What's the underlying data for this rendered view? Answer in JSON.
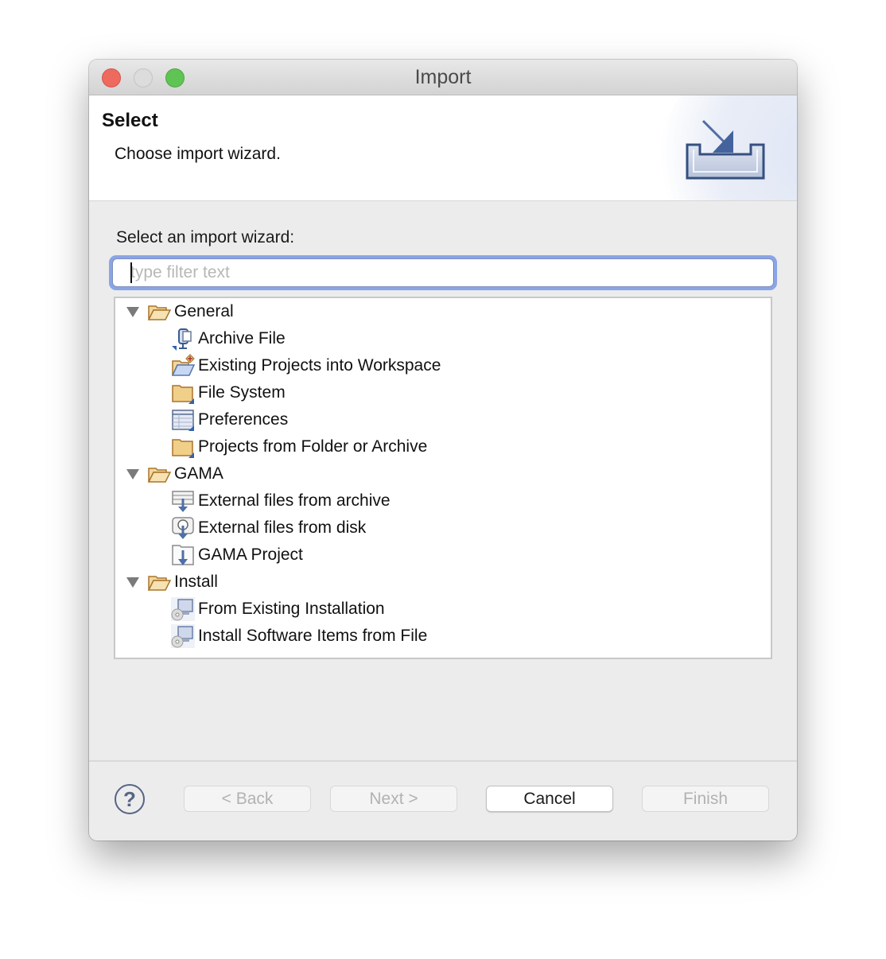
{
  "window": {
    "title": "Import",
    "controls": [
      "close",
      "minimize",
      "zoom"
    ]
  },
  "banner": {
    "title": "Select",
    "description": "Choose import wizard.",
    "icon": "import-wizard-icon"
  },
  "main": {
    "label": "Select an import wizard:",
    "filter": {
      "value": "",
      "placeholder": "type filter text"
    },
    "tree": [
      {
        "label": "General",
        "expanded": true,
        "icon": "folder-open-icon",
        "children": [
          {
            "label": "Archive File",
            "icon": "archive-file-icon"
          },
          {
            "label": "Existing Projects into Workspace",
            "icon": "existing-projects-icon"
          },
          {
            "label": "File System",
            "icon": "folder-icon"
          },
          {
            "label": "Preferences",
            "icon": "preferences-icon"
          },
          {
            "label": "Projects from Folder or Archive",
            "icon": "folder-icon"
          }
        ]
      },
      {
        "label": "GAMA",
        "expanded": true,
        "icon": "folder-open-icon",
        "children": [
          {
            "label": "External files from archive",
            "icon": "archive-download-icon"
          },
          {
            "label": "External files from disk",
            "icon": "disk-download-icon"
          },
          {
            "label": "GAMA Project",
            "icon": "project-download-icon"
          }
        ]
      },
      {
        "label": "Install",
        "expanded": true,
        "icon": "folder-open-icon",
        "children": [
          {
            "label": "From Existing Installation",
            "icon": "install-cd-icon"
          },
          {
            "label": "Install Software Items from File",
            "icon": "install-cd-icon"
          }
        ]
      }
    ]
  },
  "footer": {
    "help_icon": "?",
    "back": {
      "label": "< Back",
      "enabled": false
    },
    "next": {
      "label": "Next >",
      "enabled": false
    },
    "cancel": {
      "label": "Cancel",
      "enabled": true
    },
    "finish": {
      "label": "Finish",
      "enabled": false
    }
  },
  "colors": {
    "focus_ring": "#8aa5e6",
    "close": "#ee6a5f",
    "zoom": "#5fc454",
    "icon_blue": "#3b5a92",
    "folder": "#e8c06a"
  }
}
